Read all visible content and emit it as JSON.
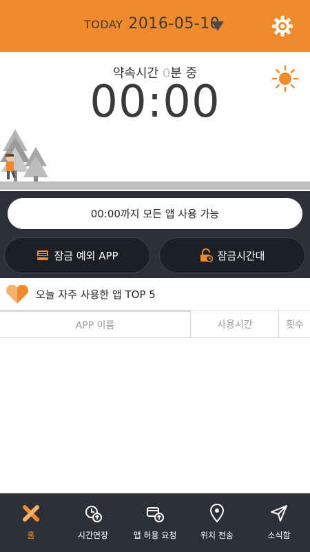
{
  "header": {
    "today_label": "TODAY",
    "date": "2016-05-10",
    "accent_color": "#f08a2c",
    "settings_icon": "gear-icon"
  },
  "status": {
    "promise_prefix": "약속시간 ",
    "promise_minutes": "0",
    "promise_suffix": "분 중",
    "timer": "00:00",
    "weather_icon": "sun-icon"
  },
  "panel": {
    "available_text": "00:00까지 모든 앱 사용 가능",
    "lock_exception_label": "잠금 예외 APP",
    "lock_time_label": "잠금시간대"
  },
  "top5": {
    "title": "오늘 자주 사용한 앱 TOP 5",
    "columns": [
      "APP 이름",
      "사용시간",
      "횟수"
    ],
    "rows": []
  },
  "nav": {
    "items": [
      {
        "label": "홈",
        "icon": "home-x-icon",
        "active": true
      },
      {
        "label": "시간연장",
        "icon": "time-extend-icon",
        "active": false
      },
      {
        "label": "앱 허용 요청",
        "icon": "app-request-icon",
        "active": false
      },
      {
        "label": "위치 전송",
        "icon": "location-pin-icon",
        "active": false
      },
      {
        "label": "소식함",
        "icon": "send-icon",
        "active": false
      }
    ]
  }
}
